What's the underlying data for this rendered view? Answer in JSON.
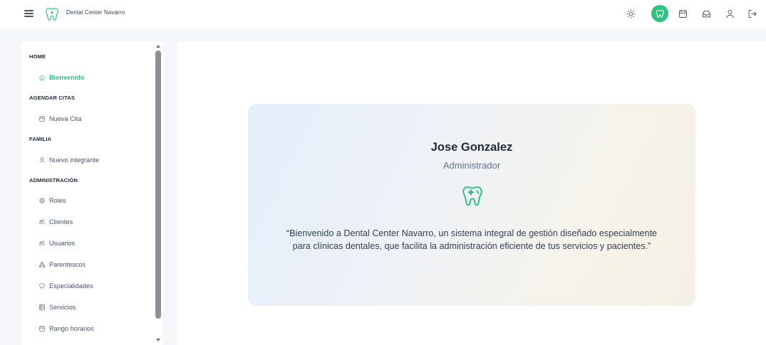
{
  "header": {
    "app_title": "Dental Center Navarro",
    "icons": [
      "menu-icon",
      "tooth-logo",
      "sun-icon",
      "tooth-icon",
      "calendar-icon",
      "inbox-icon",
      "user-icon",
      "logout-icon"
    ],
    "accent_color": "#2fc27f"
  },
  "sidebar": {
    "sections": [
      {
        "title": "HOME",
        "items": [
          {
            "label": "Bienvenido",
            "icon": "home-icon",
            "active": true
          }
        ]
      },
      {
        "title": "AGENDAR CITAS",
        "items": [
          {
            "label": "Nueva Cita",
            "icon": "calendar-icon"
          }
        ]
      },
      {
        "title": "FAMILIA",
        "items": [
          {
            "label": "Nuevo integrante",
            "icon": "user-icon"
          }
        ]
      },
      {
        "title": "ADMINISTRACIÓN",
        "items": [
          {
            "label": "Roles",
            "icon": "gear-icon"
          },
          {
            "label": "Clientes",
            "icon": "users-icon"
          },
          {
            "label": "Usuarios",
            "icon": "users-icon"
          },
          {
            "label": "Parentescos",
            "icon": "sitemap-icon"
          },
          {
            "label": "Especialidades",
            "icon": "heart-icon"
          },
          {
            "label": "Servicios",
            "icon": "list-icon"
          },
          {
            "label": "Rango horarios",
            "icon": "calendar-icon"
          }
        ]
      }
    ]
  },
  "welcome": {
    "name": "Jose Gonzalez",
    "role": "Administrador",
    "message": "“Bienvenido a Dental Center Navarro, un sistema integral de gestión diseñado especialmente para clínicas dentales, que facilita la administración eficiente de tus servicios y pacientes.”"
  }
}
